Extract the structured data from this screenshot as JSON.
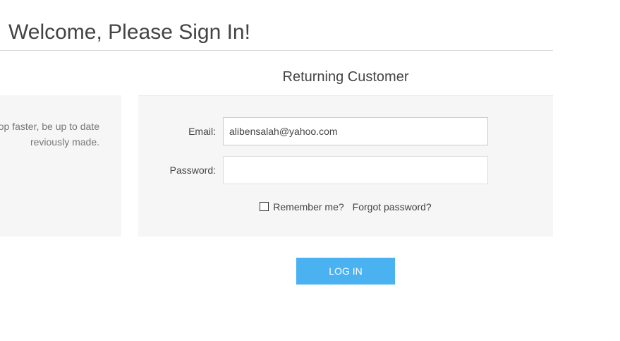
{
  "page": {
    "title": "Welcome, Please Sign In!"
  },
  "new_customer": {
    "text_lines": [
      "op faster, be up to date",
      "reviously made."
    ]
  },
  "returning_customer": {
    "heading": "Returning Customer",
    "email_label": "Email:",
    "email_value": "alibensalah@yahoo.com",
    "password_label": "Password:",
    "password_value": "",
    "remember_label": "Remember me?",
    "remember_checked": false,
    "forgot_link": "Forgot password?"
  },
  "login_button": {
    "label": "LOG IN",
    "color": "#4ab2f1"
  }
}
